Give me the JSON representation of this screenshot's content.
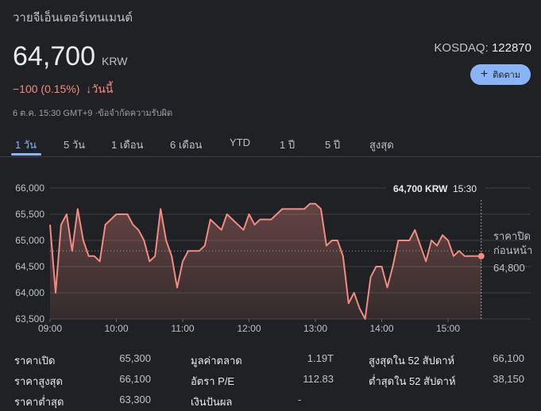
{
  "company_name": "วายจีเอ็นเตอร์เทนเมนต์",
  "price": {
    "value": "64,700",
    "currency": "KRW"
  },
  "exchange": {
    "label": "KOSDAQ:",
    "symbol": "122870"
  },
  "follow_button": {
    "label": "ติดตาม"
  },
  "change": {
    "text": "−100 (0.15%)",
    "arrow": "↓",
    "period": "วันนี้"
  },
  "meta": {
    "timestamp": "6 ต.ค. 15:30 GMT+9",
    "disclaimer": "ข้อจำกัดความรับผิด"
  },
  "tabs": [
    "1 วัน",
    "5 วัน",
    "1 เดือน",
    "6 เดือน",
    "YTD",
    "1 ปี",
    "5 ปี",
    "สูงสุด"
  ],
  "active_tab": 0,
  "colors": {
    "line": "#f28b82",
    "accent": "#8ab4f8",
    "background": "#202124"
  },
  "chart_data": {
    "type": "area",
    "x_ticks": [
      "09:00",
      "10:00",
      "11:00",
      "12:00",
      "13:00",
      "14:00",
      "15:00"
    ],
    "y_ticks": [
      "66,000",
      "65,500",
      "65,000",
      "64,500",
      "64,000",
      "63,500"
    ],
    "ylim": [
      63500,
      66000
    ],
    "xlim": [
      "09:00",
      "15:35"
    ],
    "series": [
      {
        "x": [
          "09:00",
          "09:05",
          "09:10",
          "09:15",
          "09:20",
          "09:25",
          "09:30",
          "09:35",
          "09:40",
          "09:45",
          "09:50",
          "09:55",
          "10:00",
          "10:05",
          "10:10",
          "10:15",
          "10:20",
          "10:25",
          "10:30",
          "10:35",
          "10:40",
          "10:45",
          "10:50",
          "10:55",
          "11:00",
          "11:05",
          "11:10",
          "11:15",
          "11:20",
          "11:25",
          "11:30",
          "11:35",
          "11:40",
          "11:45",
          "11:50",
          "11:55",
          "12:00",
          "12:05",
          "12:10",
          "12:15",
          "12:20",
          "12:25",
          "12:30",
          "12:35",
          "12:40",
          "12:45",
          "12:50",
          "12:55",
          "13:00",
          "13:05",
          "13:10",
          "13:15",
          "13:20",
          "13:25",
          "13:30",
          "13:35",
          "13:40",
          "13:45",
          "13:50",
          "13:55",
          "14:00",
          "14:05",
          "14:10",
          "14:15",
          "14:20",
          "14:25",
          "14:30",
          "14:35",
          "14:40",
          "14:45",
          "14:50",
          "14:55",
          "15:00",
          "15:05",
          "15:10",
          "15:15",
          "15:20",
          "15:25",
          "15:30"
        ],
        "values": [
          65300,
          64000,
          65300,
          65500,
          64800,
          65600,
          65000,
          64700,
          64700,
          64600,
          65300,
          65400,
          65500,
          65500,
          65500,
          65300,
          65200,
          65000,
          64600,
          64700,
          65600,
          65000,
          64700,
          64100,
          64600,
          64800,
          64800,
          64800,
          64900,
          65400,
          65300,
          65200,
          65500,
          65400,
          65300,
          65200,
          65500,
          65300,
          65400,
          65400,
          65400,
          65500,
          65600,
          65600,
          65600,
          65600,
          65600,
          65700,
          65700,
          65600,
          64900,
          65000,
          65000,
          64700,
          63800,
          64000,
          63700,
          63500,
          64300,
          64500,
          64500,
          64100,
          64500,
          65000,
          65000,
          65000,
          65200,
          64900,
          64600,
          65000,
          64900,
          65100,
          65000,
          64700,
          64800,
          64700,
          64700,
          64700,
          64700
        ]
      }
    ],
    "previous_close": {
      "label_line1": "ราคาปิด",
      "label_line2": "ก่อนหน้า",
      "value": 64800,
      "value_label": "64,800"
    },
    "tooltip": {
      "price": "64,700 KRW",
      "time": "15:30"
    },
    "grid": true
  },
  "stats": [
    {
      "label": "ราคาเปิด",
      "value": "65,300"
    },
    {
      "label": "ราคาสูงสุด",
      "value": "66,100"
    },
    {
      "label": "ราคาต่ำสุด",
      "value": "63,300"
    },
    {
      "label": "มูลค่าตลาด",
      "value": "1.19T"
    },
    {
      "label": "อัตรา P/E",
      "value": "112.83"
    },
    {
      "label": "เงินปันผล",
      "value": "-"
    },
    {
      "label": "สูงสุดใน 52 สัปดาห์",
      "value": "66,100"
    },
    {
      "label": "ต่ำสุดใน 52 สัปดาห์",
      "value": "38,150"
    }
  ]
}
